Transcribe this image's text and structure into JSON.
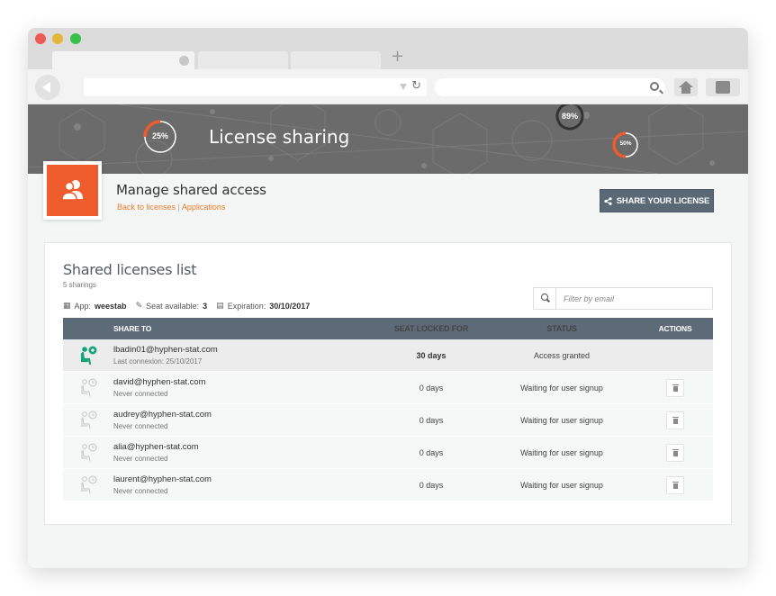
{
  "banner": {
    "title": "License sharing",
    "gauges": [
      {
        "label": "25%",
        "value": 0.25
      },
      {
        "label": "89%",
        "value": 0.89
      },
      {
        "label": "50%",
        "value": 0.5
      }
    ]
  },
  "header": {
    "title": "Manage shared access",
    "breadcrumb_back": "Back to licenses",
    "breadcrumb_sep": "|",
    "breadcrumb_apps": "Applications",
    "share_button": "SHARE YOUR LICENSE",
    "icon": "users-icon"
  },
  "card": {
    "title": "Shared licenses list",
    "subtitle": "5 sharings",
    "app_label": "App:",
    "app_value": "weestab",
    "seat_label": "Seat available:",
    "seat_value": "3",
    "expiration_label": "Expiration:",
    "expiration_value": "30/10/2017",
    "filter_placeholder": "Filter by email"
  },
  "table": {
    "columns": {
      "share_to": "SHARE TO",
      "seat": "SEAT LOCKED FOR",
      "status": "STATUS",
      "actions": "ACTIONS"
    },
    "rows": [
      {
        "email": "lbadin01@hyphen-stat.com",
        "sub": "Last connexion: 25/10/2017",
        "seat": "30 days",
        "status": "Access granted",
        "active": true
      },
      {
        "email": "david@hyphen-stat.com",
        "sub": "Never connected",
        "seat": "0 days",
        "status": "Waiting for user signup",
        "active": false
      },
      {
        "email": "audrey@hyphen-stat.com",
        "sub": "Never connected",
        "seat": "0 days",
        "status": "Waiting for user signup",
        "active": false
      },
      {
        "email": "alia@hyphen-stat.com",
        "sub": "Never connected",
        "seat": "0 days",
        "status": "Waiting for user signup",
        "active": false
      },
      {
        "email": "laurent@hyphen-stat.com",
        "sub": "Never connected",
        "seat": "0 days",
        "status": "Waiting for user signup",
        "active": false
      }
    ]
  },
  "colors": {
    "accent": "#ef5c2d",
    "link": "#e87b2c",
    "header_bar": "#5d6b78",
    "active_icon": "#1aa37a"
  }
}
